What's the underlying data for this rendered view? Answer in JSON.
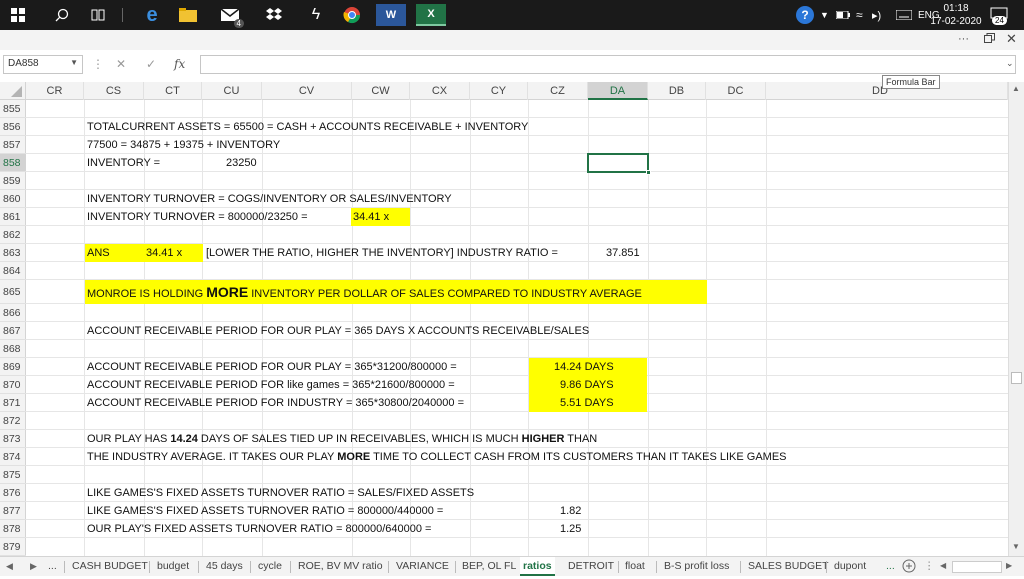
{
  "taskbar": {
    "time": "01:18",
    "date": "17-02-2020",
    "language": "ENG",
    "notification_count": "24",
    "mail_badge": "4",
    "word_label": "W",
    "excel_label": "X"
  },
  "formula_bar": {
    "name_box": "DA858",
    "fx_label": "fx",
    "value": "",
    "tooltip": "Formula Bar"
  },
  "columns": [
    "CR",
    "CS",
    "CT",
    "CU",
    "CV",
    "CW",
    "CX",
    "CY",
    "CZ",
    "DA",
    "DB",
    "DC",
    "DD"
  ],
  "rows": [
    "855",
    "856",
    "857",
    "858",
    "859",
    "860",
    "861",
    "862",
    "863",
    "864",
    "865",
    "866",
    "867",
    "868",
    "869",
    "870",
    "871",
    "872",
    "873",
    "874",
    "875",
    "876",
    "877",
    "878",
    "879"
  ],
  "cells": {
    "r856": "TOTALCURRENT ASSETS = 65500 = CASH + ACCOUNTS RECEIVABLE + INVENTORY",
    "r857": "77500 = 34875 + 19375 + INVENTORY",
    "r858_label": "INVENTORY =",
    "r858_value": "23250",
    "r860": "INVENTORY TURNOVER = COGS/INVENTORY OR SALES/INVENTORY",
    "r861": "INVENTORY TURNOVER = 800000/23250 =",
    "r861_value": "34.41 x",
    "r863_ans": "ANS",
    "r863_value": "34.41 x",
    "r863_note": "[LOWER THE RATIO, HIGHER THE INVENTORY]  INDUSTRY RATIO =",
    "r863_industry": "37.851",
    "r865_a": "MONROE  IS HOLDING ",
    "r865_b": "MORE",
    "r865_c": " INVENTORY PER DOLLAR OF SALES COMPARED TO INDUSTRY AVERAGE",
    "r867": "ACCOUNT RECEIVABLE PERIOD FOR OUR PLAY = 365 DAYS X ACCOUNTS RECEIVABLE/SALES",
    "r869": "ACCOUNT RECEIVABLE PERIOD FOR OUR PLAY = 365*31200/800000 =",
    "r869_value": "14.24 DAYS",
    "r870": "ACCOUNT RECEIVABLE PERIOD FOR like games = 365*21600/800000 =",
    "r870_value": "9.86 DAYS",
    "r871": "ACCOUNT RECEIVABLE PERIOD FOR INDUSTRY = 365*30800/2040000 =",
    "r871_value": "5.51 DAYS",
    "r873_a": "OUR PLAY HAS ",
    "r873_b": "14.24",
    "r873_c": " DAYS OF SALES TIED UP IN RECEIVABLES, WHICH IS MUCH ",
    "r873_d": "HIGHER",
    "r873_e": " THAN",
    "r874_a": "THE INDUSTRY AVERAGE. IT TAKES OUR PLAY ",
    "r874_b": "MORE",
    "r874_c": " TIME TO COLLECT CASH FROM ITS CUSTOMERS THAN IT TAKES LIKE GAMES",
    "r876": "LIKE GAMES'S FIXED ASSETS TURNOVER RATIO = SALES/FIXED ASSETS",
    "r877": "LIKE GAMES'S FIXED ASSETS TURNOVER RATIO = 800000/440000 =",
    "r877_value": "1.82",
    "r878": "OUR PLAY'S FIXED ASSETS TURNOVER RATIO = 800000/640000 =",
    "r878_value": "1.25"
  },
  "sheet_tabs": [
    "...",
    "CASH BUDGET",
    "budget",
    "45 days",
    "cycle",
    "ROE, BV MV ratio",
    "VARIANCE",
    "BEP, OL FL",
    "ratios",
    "DETROIT",
    "float",
    "B-S profit loss",
    "SALES BUDGET",
    "dupont",
    "..."
  ],
  "active_tab": "ratios",
  "colors": {
    "highlight": "#ffff00",
    "excel_green": "#217346"
  }
}
